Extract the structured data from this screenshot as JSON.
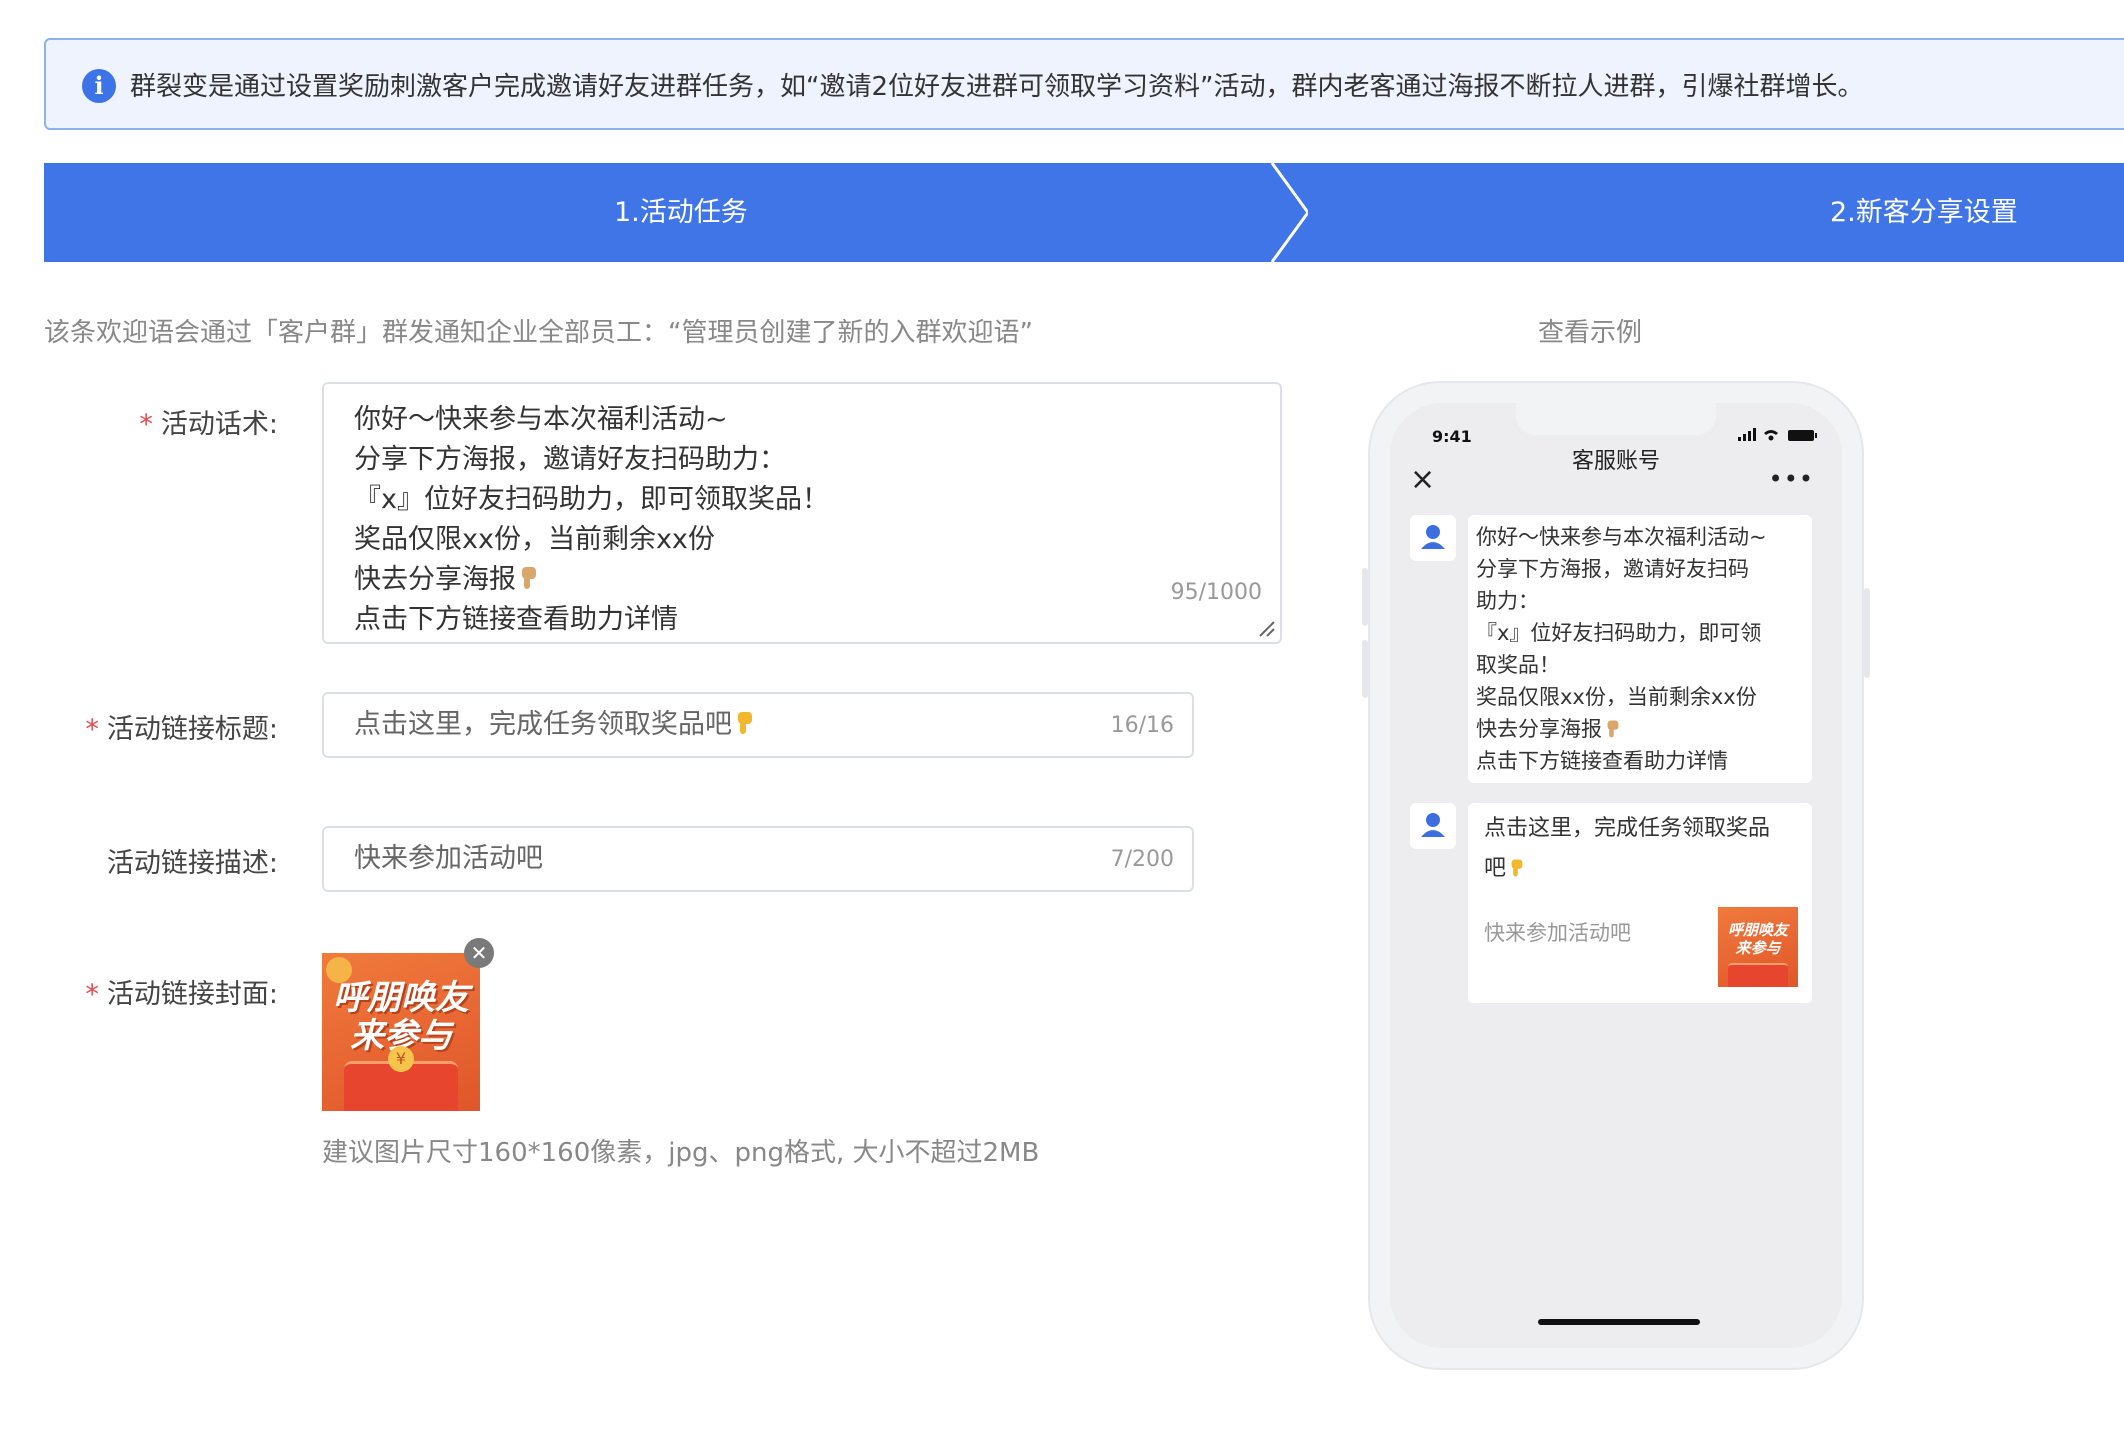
{
  "notice": {
    "text": "群裂变是通过设置奖励刺激客户完成邀请好友进群任务，如“邀请2位好友进群可领取学习资料”活动，群内老客通过海报不断拉人进群，引爆社群增长。"
  },
  "steps": [
    {
      "label": "1.活动任务"
    },
    {
      "label": "2.新客分享设置"
    }
  ],
  "tip": "该条欢迎语会通过「客户群」群发通知企业全部员工：“管理员创建了新的入群欢迎语”",
  "example_link": "查看示例",
  "form": {
    "script": {
      "label": "活动话术:",
      "lines": [
        "你好～快来参与本次福利活动~",
        "分享下方海报，邀请好友扫码助力：",
        "『x』位好友扫码助力，即可领取奖品！",
        "奖品仅限xx份，当前剩余xx份",
        "快去分享海报",
        "点击下方链接查看助力详情"
      ],
      "counter": "95/1000"
    },
    "link_title": {
      "label": "活动链接标题:",
      "value": "点击这里，完成任务领取奖品吧",
      "counter": "16/16"
    },
    "link_desc": {
      "label": "活动链接描述:",
      "value": "快来参加活动吧",
      "counter": "7/200"
    },
    "link_cover": {
      "label": "活动链接封面:",
      "cover_text": [
        "呼朋唤友",
        "来参与"
      ],
      "coin_symbol": "¥",
      "hint": "建议图片尺寸160*160像素，jpg、png格式, 大小不超过2MB"
    }
  },
  "phone": {
    "time": "9:41",
    "nav_title": "客服账号",
    "close_icon": "×",
    "more_icon": "•••",
    "message_lines": [
      "你好～快来参与本次福利活动~",
      "分享下方海报，邀请好友扫码",
      "助力：",
      "『x』位好友扫码助力，即可领",
      "取奖品！",
      "奖品仅限xx份，当前剩余xx份",
      "快去分享海报",
      "点击下方链接查看助力详情"
    ],
    "card": {
      "title_lines": [
        "点击这里，完成任务领取奖品",
        "吧"
      ],
      "desc": "快来参加活动吧",
      "thumb_text": [
        "呼朋唤友",
        "来参与"
      ]
    }
  },
  "colors": {
    "primary": "#3f75e6",
    "required": "#e5484d"
  }
}
